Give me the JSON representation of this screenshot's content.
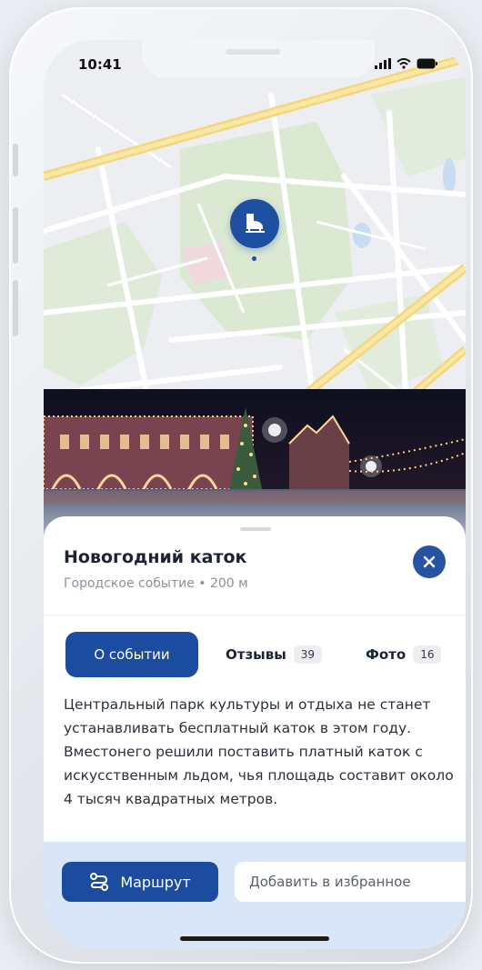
{
  "status_bar": {
    "time": "10:41"
  },
  "map": {
    "pin_icon": "ice-skate-icon"
  },
  "event": {
    "title": "Новогодний каток",
    "subtitle": "Городское событие • 200 м",
    "close_icon": "close-icon"
  },
  "tabs": [
    {
      "label": "О событии",
      "active": true
    },
    {
      "label": "Отзывы",
      "count": "39"
    },
    {
      "label": "Фото",
      "count": "16"
    }
  ],
  "description": "Центральный парк культуры и отдыха не станет устанавливать бесплатный каток в этом году. Вместонего решили поставить платный каток с искусственным льдом, чья площадь составит около 4 тысяч квадратных метров.",
  "actions": {
    "route_label": "Маршрут",
    "route_icon": "route-icon",
    "favorite_label": "Добавить в избранное"
  },
  "colors": {
    "accent": "#1c4ca0",
    "action_bar_bg": "#d9e6f7"
  }
}
